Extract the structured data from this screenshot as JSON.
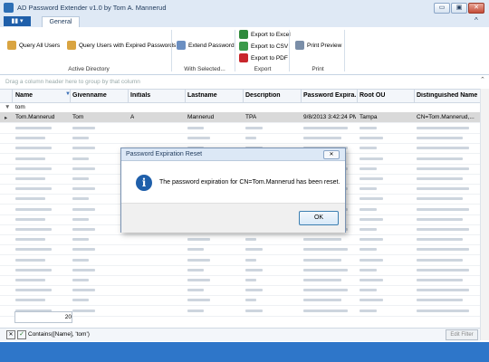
{
  "window": {
    "title": "AD Password Extender v1.0 by Tom A. Mannerud",
    "minimize": "▭",
    "maximize": "▣",
    "close": "✕"
  },
  "ribbon": {
    "tabs": [
      "General"
    ],
    "collapse": "^",
    "buttons": {
      "query_all": "Query All Users",
      "query_expired": "Query Users with Expired Passwords",
      "extend_password": "Extend Password",
      "export_excel": "Export to Excel",
      "export_csv": "Export to CSV",
      "export_pdf": "Export to PDF",
      "print_preview": "Print Preview"
    },
    "groups": {
      "active_directory": "Active Directory",
      "with_selected": "With Selected...",
      "export": "Export",
      "print": "Print"
    }
  },
  "grid": {
    "group_hint": "Drag a column header here to group by that column",
    "columns": [
      "Name",
      "Givenname",
      "Initials",
      "Lastname",
      "Description",
      "Password Expira...",
      "Root OU",
      "Distinguished Name"
    ],
    "filter_value": "tom",
    "selected_row": [
      "Tom.Mannerud",
      "Tom",
      "A",
      "Mannerud",
      "TPA",
      "9/8/2013 3:42:24 PM",
      "Tampa",
      "CN=Tom.Mannerud,..."
    ],
    "row_count": "20"
  },
  "filter_bar": {
    "expression": "Contains([Name], 'tom')",
    "edit_label": "Edit Filter",
    "clear_icon": "✕",
    "check_icon": "✓"
  },
  "dialog": {
    "title": "Password Expiration Reset",
    "close": "✕",
    "message": "The password expiration for CN=Tom.Mannerud has been reset.",
    "ok_label": "OK"
  }
}
